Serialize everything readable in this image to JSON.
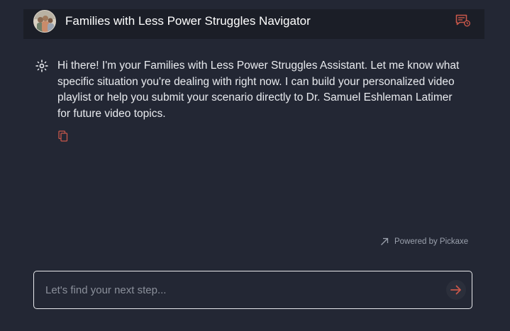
{
  "header": {
    "title": "Families with Less Power Struggles Navigator",
    "avatar_icon": "family-photo-avatar",
    "history_icon": "chat-history-icon"
  },
  "messages": [
    {
      "role": "assistant",
      "icon": "sparkle-bot-icon",
      "text": "Hi there! I'm your Families with Less Power Struggles Assistant. Let me know what specific situation you're dealing with right now. I can build your personalized video playlist or help you submit your scenario directly to Dr. Samuel Eshleman Latimer for future video topics.",
      "action_icon": "copy-icon"
    }
  ],
  "footer": {
    "powered_by": "Powered by Pickaxe",
    "powered_icon": "arrow-up-left-icon"
  },
  "composer": {
    "placeholder": "Let's find your next step...",
    "value": "",
    "send_icon": "arrow-right-icon"
  },
  "colors": {
    "background": "#232734",
    "header_background": "#1b1e27",
    "accent": "#c8574a",
    "text": "#e9ebef",
    "muted": "#9ba1ad"
  }
}
